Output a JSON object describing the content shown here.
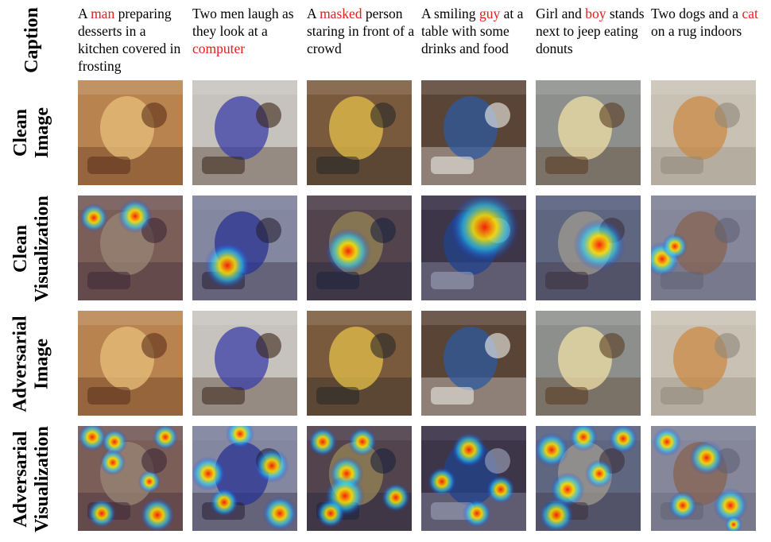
{
  "row_labels": [
    "Caption",
    "Clean\nImage",
    "Clean\nVisualization",
    "Adversarial\nImage",
    "Adversarial\nVisualization"
  ],
  "captions": [
    {
      "pre": "A ",
      "highlight": "man",
      "post": " preparing desserts in a kitchen covered in frosting"
    },
    {
      "pre": "Two men laugh as they look at a ",
      "highlight": "computer",
      "post": ""
    },
    {
      "pre": "A ",
      "highlight": "masked",
      "post": " person staring in front of a crowd"
    },
    {
      "pre": "A smiling ",
      "highlight": "guy",
      "post": " at a table with some drinks and food"
    },
    {
      "pre": "Girl and ",
      "highlight": "boy",
      "post": " stands next to jeep eating donuts"
    },
    {
      "pre": "Two dogs and a ",
      "highlight": "cat",
      "post": " on a rug indoors"
    }
  ],
  "colors": {
    "highlight": "#e0201b",
    "text": "#000000"
  },
  "scenes": [
    {
      "name": "dessert-kitchen",
      "bg": "#b8834f",
      "accent": "#e8c07a",
      "detail": "#5a2f1b"
    },
    {
      "name": "two-men-computer",
      "bg": "#c6c2bd",
      "accent": "#3b3fa8",
      "detail": "#3a2416"
    },
    {
      "name": "masked-person-crowd",
      "bg": "#7a5a3c",
      "accent": "#e6c04a",
      "detail": "#262626"
    },
    {
      "name": "smiling-guy-table",
      "bg": "#5a4436",
      "accent": "#2e5aa0",
      "detail": "#f2f2ee"
    },
    {
      "name": "girl-boy-jeep",
      "bg": "#8d8f8c",
      "accent": "#f0e0a6",
      "detail": "#5a3a22"
    },
    {
      "name": "dogs-cat-rug",
      "bg": "#c9c2b4",
      "accent": "#c98a44",
      "detail": "#8f877a"
    }
  ]
}
